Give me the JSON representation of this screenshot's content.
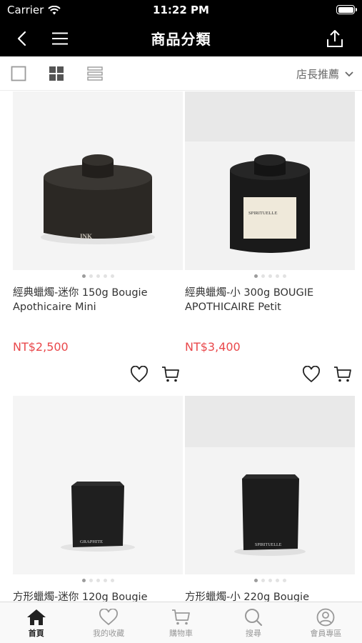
{
  "status": {
    "carrier": "Carrier",
    "time": "11:22 PM"
  },
  "navbar": {
    "title": "商品分類"
  },
  "toolbar": {
    "sort_label": "店長推薦"
  },
  "products": [
    {
      "name": "經典蠟燭-迷你 150g Bougie Apothicaire Mini",
      "price": "NT$2,500",
      "label": "INK"
    },
    {
      "name": "經典蠟燭-小 300g BOUGIE APOTHICAIRE Petit",
      "price": "NT$3,400",
      "label": "SPIRITUELLE"
    },
    {
      "name": "方形蠟燭-迷你 120g Bougie",
      "price": "",
      "label": "GRAPHITE"
    },
    {
      "name": "方形蠟燭-小 220g Bougie",
      "price": "",
      "label": "SPIRITUELLE"
    }
  ],
  "tabbar": {
    "items": [
      {
        "label": "首頁",
        "icon": "home-icon"
      },
      {
        "label": "我的收藏",
        "icon": "heart-icon"
      },
      {
        "label": "購物車",
        "icon": "cart-icon"
      },
      {
        "label": "搜尋",
        "icon": "search-icon"
      },
      {
        "label": "會員專區",
        "icon": "user-icon"
      }
    ]
  },
  "colors": {
    "price": "#e9484b",
    "bar": "#000000"
  }
}
